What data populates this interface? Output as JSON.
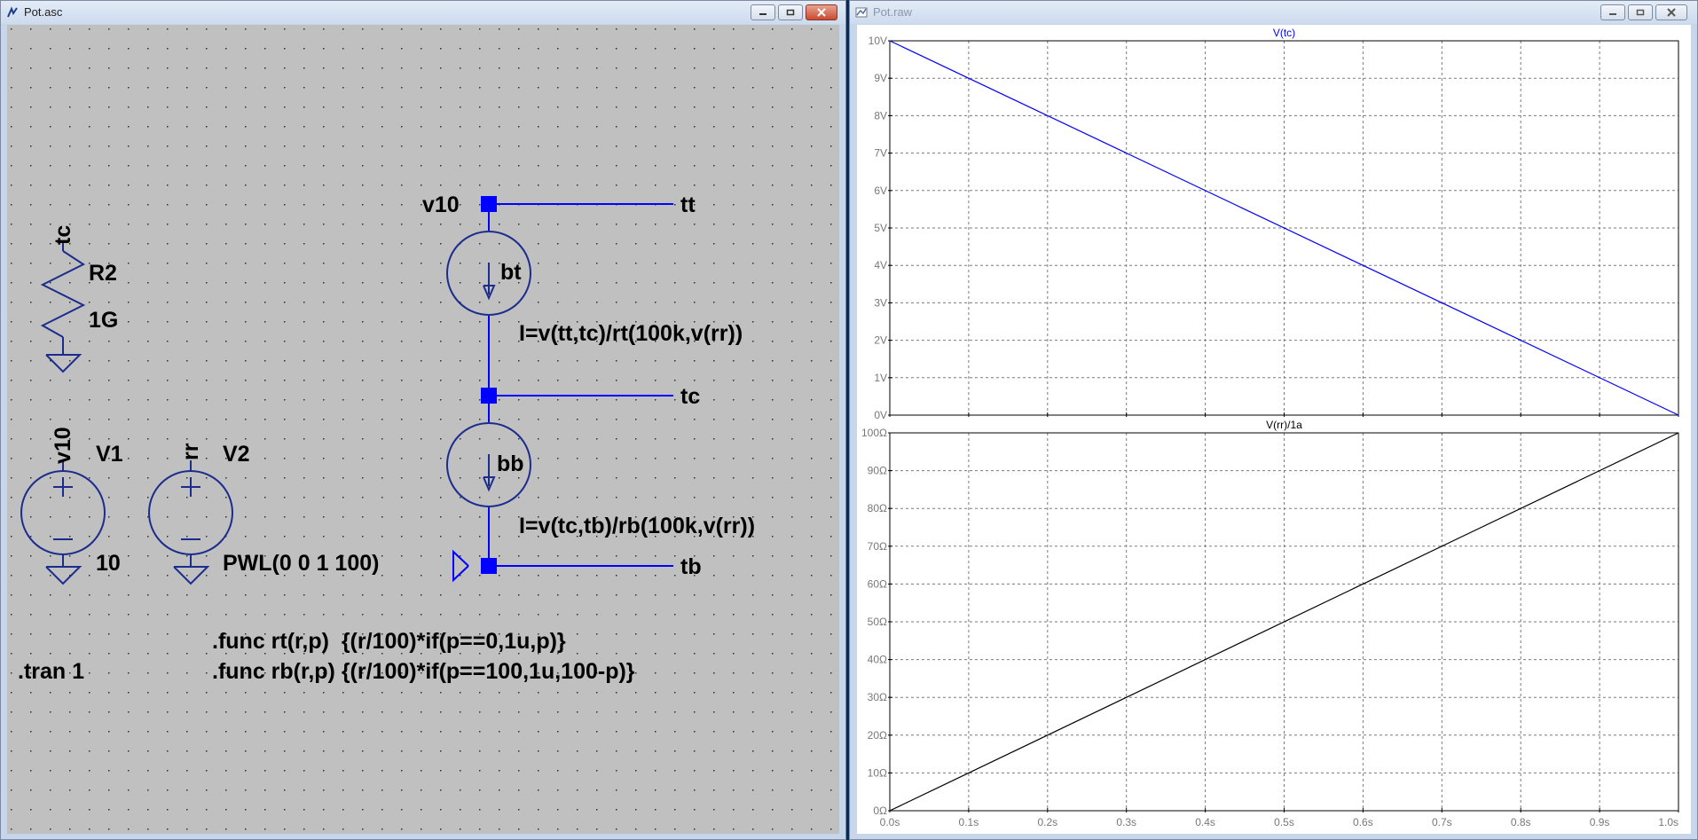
{
  "schematic_window": {
    "title": "Pot.asc",
    "components": {
      "r2": {
        "net": "tc",
        "name": "R2",
        "value": "1G"
      },
      "v1": {
        "net": "v10",
        "name": "V1",
        "value": "10"
      },
      "v2": {
        "net": "rr",
        "name": "V2",
        "value": "PWL(0 0 1 100)"
      },
      "bt": {
        "name": "bt",
        "expr": "I=v(tt,tc)/rt(100k,v(rr))"
      },
      "bb": {
        "name": "bb",
        "expr": "I=v(tc,tb)/rb(100k,v(rr))"
      }
    },
    "net_labels": {
      "v10": "v10",
      "tt": "tt",
      "tc": "tc",
      "tb": "tb"
    },
    "directives": {
      "tran": ".tran 1",
      "func_rt": ".func rt(r,p)  {(r/100)*if(p==0,1u,p)}",
      "func_rb": ".func rb(r,p) {(r/100)*if(p==100,1u,100-p)}"
    }
  },
  "plot_window": {
    "title": "Pot.raw",
    "colors": {
      "trace_top": "#0000ff",
      "trace_bottom": "#000000",
      "grid": "#7a7a7a",
      "axis_text": "#777777",
      "pane_border": "#000000"
    },
    "x_tick_labels": [
      "0.0s",
      "0.1s",
      "0.2s",
      "0.3s",
      "0.4s",
      "0.5s",
      "0.6s",
      "0.7s",
      "0.8s",
      "0.9s",
      "1.0s"
    ],
    "panes": [
      {
        "title": "V(tc)",
        "y_tick_labels": [
          "0V",
          "1V",
          "2V",
          "3V",
          "4V",
          "5V",
          "6V",
          "7V",
          "8V",
          "9V",
          "10V"
        ]
      },
      {
        "title": "V(rr)/1a",
        "y_tick_labels": [
          "0Ω",
          "10Ω",
          "20Ω",
          "30Ω",
          "40Ω",
          "50Ω",
          "60Ω",
          "70Ω",
          "80Ω",
          "90Ω",
          "100Ω"
        ]
      }
    ]
  },
  "chart_data": [
    {
      "type": "line",
      "title": "V(tc)",
      "x": [
        0,
        1
      ],
      "series": [
        {
          "name": "V(tc)",
          "values": [
            10,
            0
          ]
        }
      ],
      "xlim": [
        0,
        1
      ],
      "ylim": [
        0,
        10
      ],
      "grid": true
    },
    {
      "type": "line",
      "title": "V(rr)/1a",
      "x": [
        0,
        1
      ],
      "series": [
        {
          "name": "V(rr)/1a",
          "values": [
            0,
            100
          ]
        }
      ],
      "xlim": [
        0,
        1
      ],
      "ylim": [
        0,
        100
      ],
      "grid": true
    }
  ]
}
